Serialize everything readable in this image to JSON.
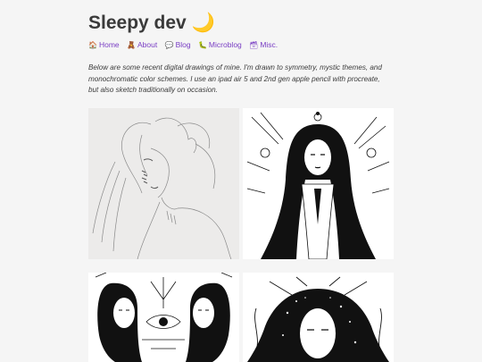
{
  "site": {
    "title": "Sleepy dev",
    "title_icon": "🌙"
  },
  "nav": [
    {
      "icon": "🏠",
      "icon_name": "home-icon",
      "label": "Home"
    },
    {
      "icon": "🧸",
      "icon_name": "teddy-bear-icon",
      "label": "About"
    },
    {
      "icon": "💬",
      "icon_name": "speech-bubble-icon",
      "label": "Blog"
    },
    {
      "icon": "🐛",
      "icon_name": "bug-icon",
      "label": "Microblog"
    },
    {
      "icon": "🗃",
      "icon_name": "card-box-icon",
      "label": "Misc."
    }
  ],
  "intro": "Below are some recent digital drawings of mine. I'm drawn to symmetry, mystic themes, and monochromatic color schemes. I use an ipad air 5 and 2nd gen apple pencil with procreate, but also sketch traditionally on occasion.",
  "colors": {
    "link": "#7a3fc4",
    "background": "#f5f5f5",
    "text": "#3a3a3a"
  },
  "gallery": [
    {
      "subject": "pencil sketch of a woman with stitched scar on face"
    },
    {
      "subject": "ink drawing of a woman with long hair and eyes motif"
    },
    {
      "subject": "symmetrical ink drawing of two mirrored women and an eye"
    },
    {
      "subject": "ink drawing of a woman with flowing hair and stars"
    }
  ]
}
